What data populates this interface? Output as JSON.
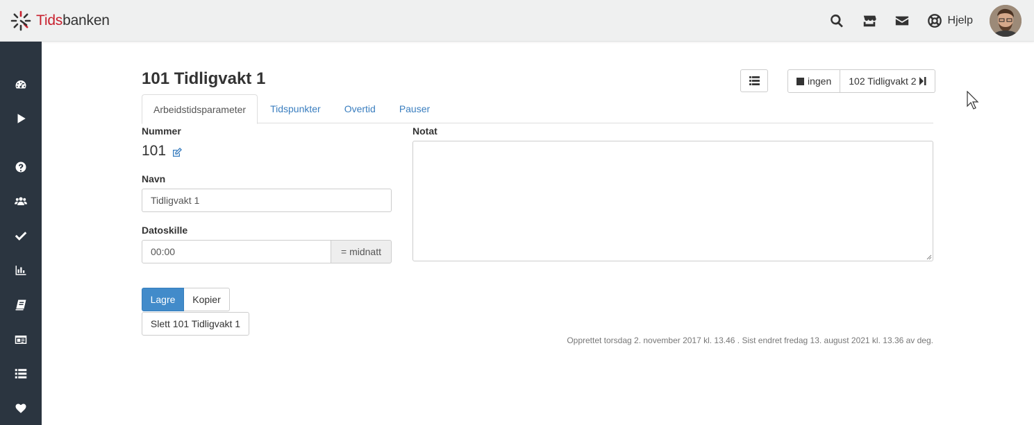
{
  "brand": {
    "part1": "Tids",
    "part2": "banken",
    "accent": "#c8202e"
  },
  "topbar": {
    "icons": [
      "search-icon",
      "store-icon",
      "mail-icon"
    ],
    "help_label": "Hjelp"
  },
  "sidebar": {
    "items": [
      "dashboard-icon",
      "play-icon",
      "help-circle-icon",
      "users-icon",
      "check-icon",
      "bar-chart-icon",
      "book-icon",
      "id-card-icon",
      "list-icon",
      "heart-icon"
    ],
    "background": "#2b3540"
  },
  "page": {
    "title": "101 Tidligvakt 1",
    "nav_none_label": "ingen",
    "nav_next_label": "102 Tidligvakt 2"
  },
  "tabs": [
    {
      "label": "Arbeidstidsparameter",
      "active": true
    },
    {
      "label": "Tidspunkter",
      "active": false
    },
    {
      "label": "Overtid",
      "active": false
    },
    {
      "label": "Pauser",
      "active": false
    }
  ],
  "form": {
    "number_label": "Nummer",
    "number_value": "101",
    "name_label": "Navn",
    "name_value": "Tidligvakt 1",
    "date_sep_label": "Datoskille",
    "date_sep_value": "00:00",
    "date_sep_addon": "= midnatt",
    "note_label": "Notat",
    "note_value": ""
  },
  "actions": {
    "save_label": "Lagre",
    "copy_label": "Kopier",
    "delete_label": "Slett 101 Tidligvakt 1"
  },
  "meta": {
    "created_text": "Opprettet torsdag 2. november 2017 kl. 13.46 . Sist endret fredag 13. august 2021 kl. 13.36 av deg."
  },
  "colors": {
    "primary": "#428bca",
    "link": "#3a7ebf"
  }
}
